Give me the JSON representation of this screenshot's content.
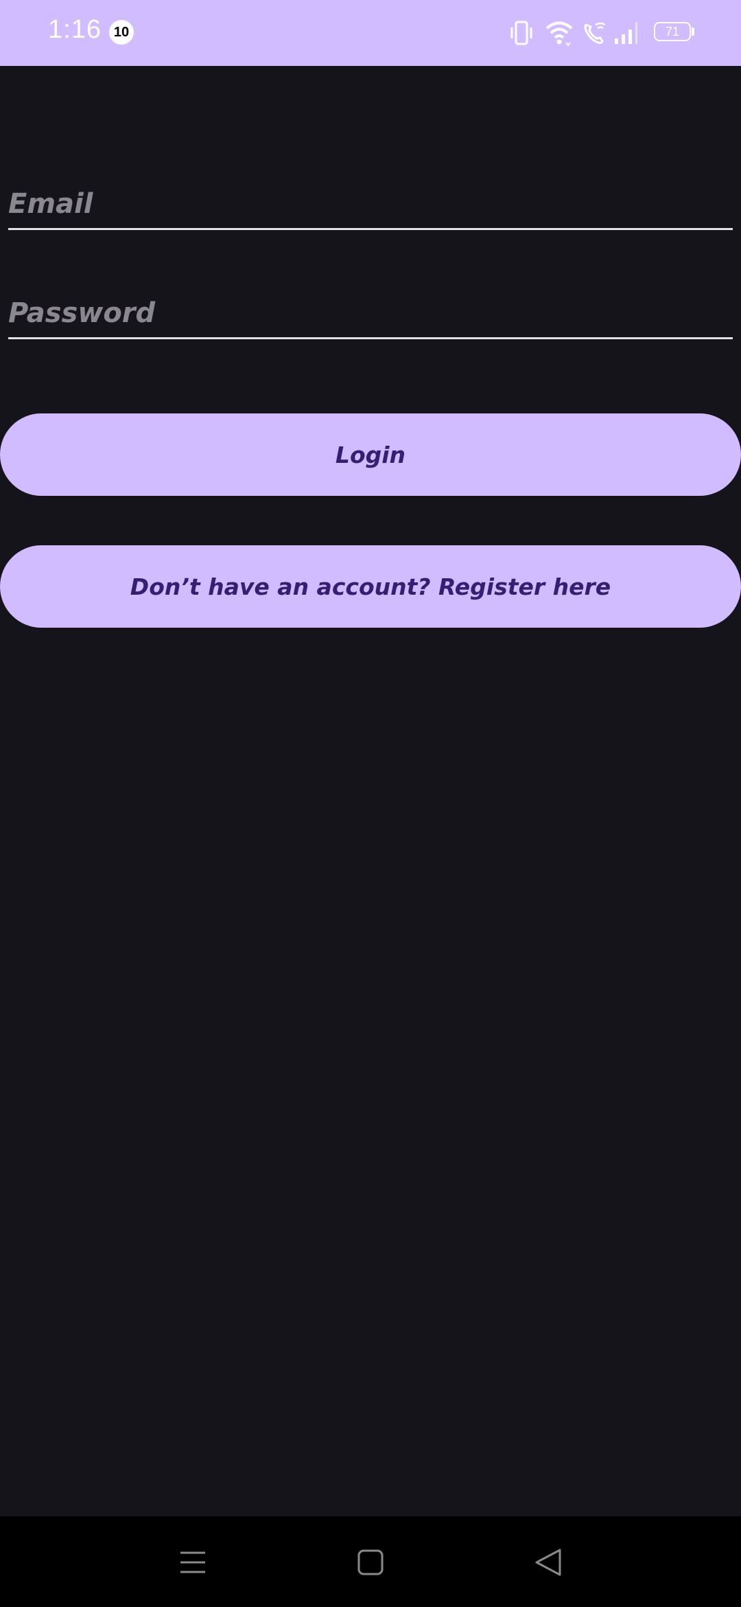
{
  "status_bar": {
    "time": "1:16",
    "notification_count": "10",
    "battery_level": "71",
    "icons": [
      "vibrate-icon",
      "wifi-icon",
      "wifi-calling-icon",
      "signal-icon",
      "battery-icon"
    ]
  },
  "form": {
    "email": {
      "placeholder": "Email",
      "value": ""
    },
    "password": {
      "placeholder": "Password",
      "value": ""
    },
    "login_label": "Login",
    "register_label": "Don’t have an account? Register here"
  },
  "nav_bar": {
    "icons": [
      "recent-apps-icon",
      "home-icon",
      "back-icon"
    ]
  },
  "colors": {
    "background": "#16141b",
    "primary": "#d0bcff",
    "on_primary": "#381e72",
    "input_line": "#e6e1e8",
    "placeholder": "#8b8790",
    "nav_background": "#000000"
  }
}
